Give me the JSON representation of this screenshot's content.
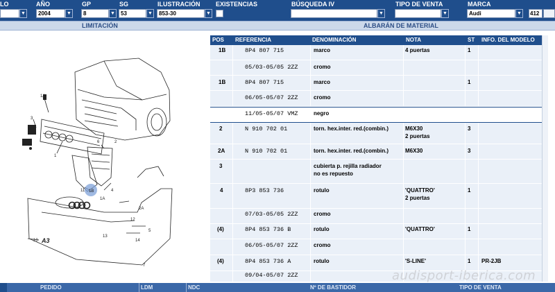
{
  "filters": {
    "modelo": {
      "label": "LO",
      "value": ""
    },
    "ano": {
      "label": "AÑO",
      "value": "2004"
    },
    "gp": {
      "label": "GP",
      "value": "8"
    },
    "sg": {
      "label": "SG",
      "value": "53"
    },
    "ilustracion": {
      "label": "ILUSTRACIÓN",
      "value": "853-30"
    },
    "existencias": {
      "label": "EXISTENCIAS"
    },
    "busqueda": {
      "label": "BÚSQUEDA IV",
      "value": ""
    },
    "tipo_venta": {
      "label": "TIPO DE VENTA",
      "value": ""
    },
    "marca": {
      "label": "MARCA",
      "value": "Audi",
      "extra": "412"
    }
  },
  "sections": {
    "left": "LIMITACIÓN",
    "right": "ALBARÁN DE MATERIAL"
  },
  "diagram": {
    "callouts": [
      "1",
      "11",
      "1B",
      "1A",
      "2",
      "2A",
      "3",
      "4",
      "5",
      "6",
      "7",
      "8",
      "9",
      "10",
      "12",
      "13",
      "14"
    ],
    "emblem_text": "A3"
  },
  "table": {
    "headers": [
      "POS",
      "REFERENCIA",
      "DENOMINACIÓN",
      "NOTA",
      "ST",
      "INFO. DEL MODELO"
    ],
    "rows": [
      {
        "pos": "1B",
        "ref": "8P4 807 715",
        "denom": "marco",
        "nota": "4 puertas",
        "st": "1",
        "info": ""
      },
      {
        "pos": "",
        "ref": "05/03-05/05 2ZZ",
        "denom": "cromo",
        "nota": "",
        "st": "",
        "info": ""
      },
      {
        "pos": "1B",
        "ref": "8P4 807 715",
        "denom": "marco",
        "nota": "",
        "st": "1",
        "info": ""
      },
      {
        "pos": "",
        "ref": "06/05-05/07 2ZZ",
        "denom": "cromo",
        "nota": "",
        "st": "",
        "info": ""
      },
      {
        "pos": "",
        "ref": "11/05-05/07 VMZ",
        "denom": "negro",
        "nota": "",
        "st": "",
        "info": ""
      },
      {
        "pos": "2",
        "ref": "N    910 702 01",
        "denom": "torn. hex.inter. red.(combin.)",
        "nota": "M6X30",
        "nota2": "2 puertas",
        "st": "3",
        "info": ""
      },
      {
        "pos": "2A",
        "ref": "N    910 702 01",
        "denom": "torn. hex.inter. red.(combin.)",
        "nota": "M6X30",
        "st": "3",
        "info": ""
      },
      {
        "pos": "3",
        "ref": "",
        "denom": "cubierta p. rejilla radiador",
        "denom2": "no es repuesto",
        "nota": "",
        "st": "",
        "info": ""
      },
      {
        "pos": "4",
        "ref": "8P3 853 736",
        "denom": "rotulo",
        "nota": "'QUATTRO'",
        "nota2": "2 puertas",
        "st": "1",
        "info": ""
      },
      {
        "pos": "",
        "ref": "07/03-05/05 2ZZ",
        "denom": "cromo",
        "nota": "",
        "st": "",
        "info": ""
      },
      {
        "pos": "(4)",
        "ref": "8P4 853 736 B",
        "denom": "rotulo",
        "nota": "'QUATTRO'",
        "st": "1",
        "info": ""
      },
      {
        "pos": "",
        "ref": "06/05-05/07 2ZZ",
        "denom": "cromo",
        "nota": "",
        "st": "",
        "info": ""
      },
      {
        "pos": "(4)",
        "ref": "8P4 853 736 A",
        "denom": "rotulo",
        "nota": "'S-LINE'",
        "st": "1",
        "info": "PR-2JB"
      },
      {
        "pos": "",
        "ref": "09/04-05/07 2ZZ",
        "denom": "",
        "nota": "",
        "st": "",
        "info": ""
      }
    ]
  },
  "bottom": {
    "pedido": "PEDIDO",
    "ldm": "LDM",
    "ndc": "NDC",
    "bastidor": "Nº DE BASTIDOR",
    "tipo_venta": "TIPO DE VENTA"
  },
  "watermark": "audisport-iberica.com",
  "colors": {
    "header_blue": "#1f4e8c",
    "table_bg": "#eaf0f8",
    "section_bg": "#ccd9ea"
  }
}
